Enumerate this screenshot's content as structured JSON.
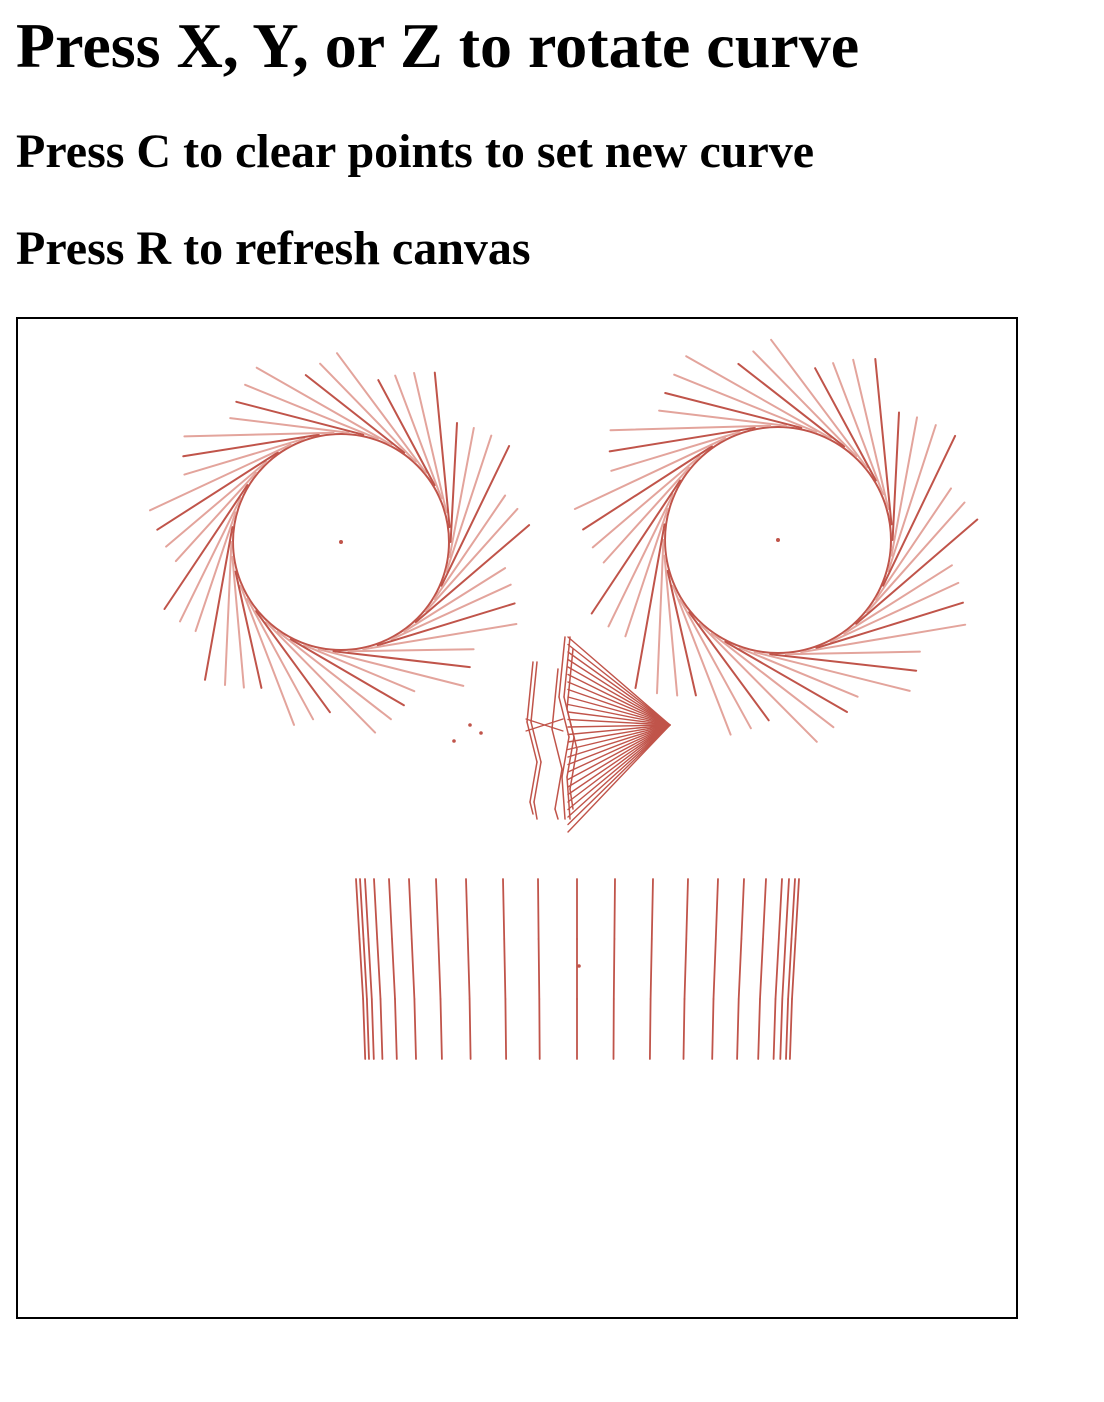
{
  "instructions": {
    "rotate": "Press X, Y, or Z to rotate curve",
    "clear": "Press C to clear points to set new curve",
    "refresh": "Press R to refresh canvas"
  },
  "colors": {
    "stroke_dark": "#c0544a",
    "stroke_light": "#e3a49c",
    "border": "#000000",
    "background": "#ffffff"
  }
}
